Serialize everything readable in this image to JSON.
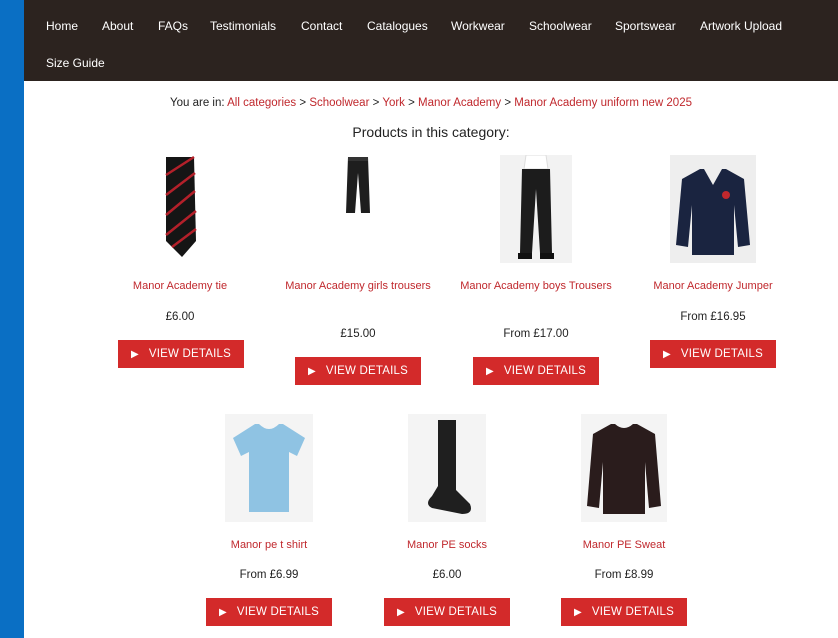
{
  "nav": {
    "items": [
      "Home",
      "About",
      "FAQs",
      "Testimonials",
      "Contact",
      "Catalogues",
      "Workwear",
      "Schoolwear",
      "Sportswear",
      "Artwork Upload",
      "Size Guide"
    ]
  },
  "breadcrumb": {
    "prefix": "You are in:",
    "links": [
      "All categories",
      "Schoolwear",
      "York",
      "Manor Academy",
      "Manor Academy uniform new 2025"
    ],
    "separator": ">"
  },
  "section_title": "Products in this category:",
  "button_label": "VIEW DETAILS",
  "products": [
    {
      "name": "Manor Academy tie",
      "price": "£6.00",
      "image": "tie"
    },
    {
      "name": "Manor Academy girls trousers",
      "price": "£15.00",
      "image": "trousers"
    },
    {
      "name": "Manor Academy boys Trousers",
      "price": "From £17.00",
      "image": "trousers"
    },
    {
      "name": "Manor Academy Jumper",
      "price": "From £16.95",
      "image": "jumper"
    },
    {
      "name": "Manor pe t shirt",
      "price": "From £6.99",
      "image": "t-shirt"
    },
    {
      "name": "Manor PE socks",
      "price": "£6.00",
      "image": "sock"
    },
    {
      "name": "Manor PE Sweat",
      "price": "From £8.99",
      "image": "sweatshirt"
    }
  ],
  "colors": {
    "accent": "#c0282d",
    "button": "#d32a2a",
    "nav_bg": "#2c231f",
    "frame": "#0a6fc4"
  }
}
